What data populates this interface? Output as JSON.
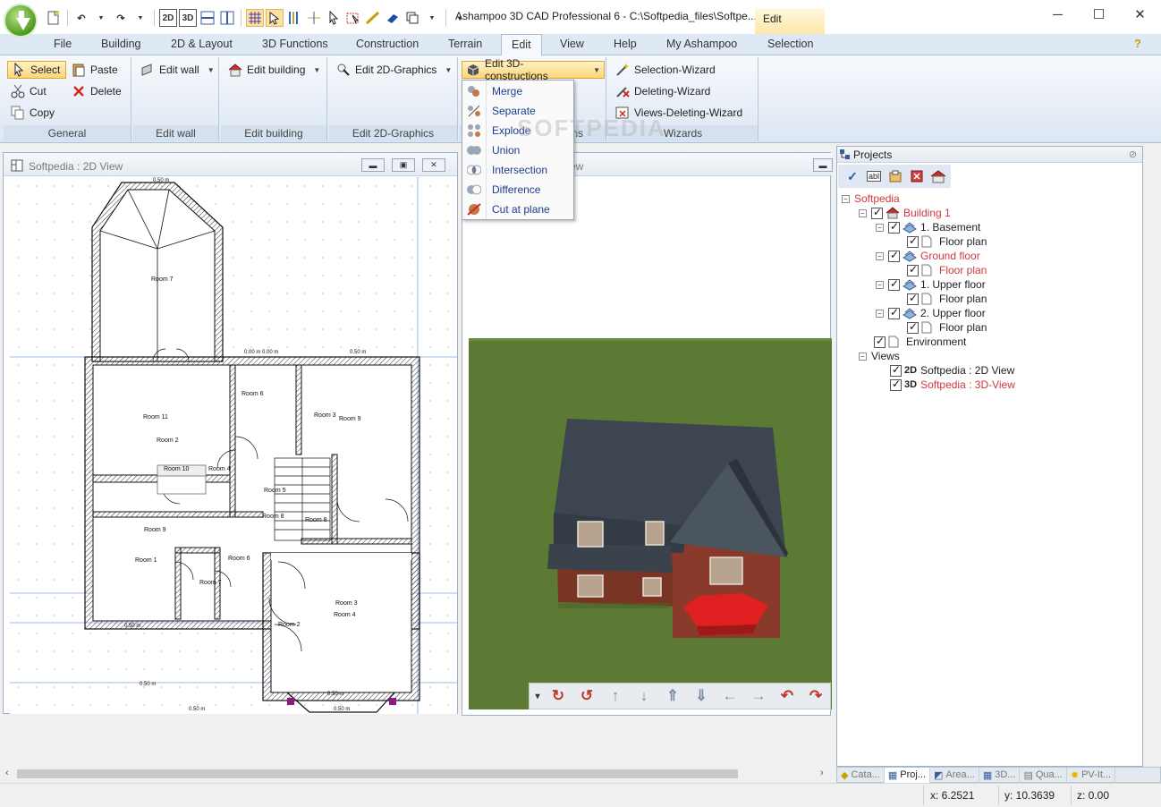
{
  "window": {
    "title": "Ashampoo 3D CAD Professional 6 - C:\\Softpedia_files\\Softpe...",
    "context_tab": "Edit",
    "minimize": "─",
    "maximize": "☐",
    "close": "✕"
  },
  "quick_access": [
    {
      "name": "new-icon",
      "label": ""
    },
    {
      "name": "undo-icon",
      "label": "↶"
    },
    {
      "name": "redo-icon",
      "label": "↷"
    },
    {
      "name": "view-2d-icon",
      "label": "2D"
    },
    {
      "name": "view-3d-icon",
      "label": "3D"
    }
  ],
  "ribbon_tabs": [
    "File",
    "Building",
    "2D & Layout",
    "3D Functions",
    "Construction",
    "Terrain",
    "Edit",
    "View",
    "Help",
    "My Ashampoo",
    "Selection"
  ],
  "active_tab": "Edit",
  "ribbon": {
    "general": {
      "label": "General",
      "select": "Select",
      "cut": "Cut",
      "copy": "Copy",
      "paste": "Paste",
      "delete": "Delete"
    },
    "edit_wall": {
      "label": "Edit wall",
      "button": "Edit wall"
    },
    "edit_building": {
      "label": "Edit building",
      "button": "Edit building"
    },
    "edit_2d": {
      "label": "Edit 2D-Graphics",
      "button": "Edit 2D-Graphics"
    },
    "edit_3d": {
      "button": "Edit 3D-constructions",
      "group_label_partial": "ns"
    },
    "wizards": {
      "label": "Wizards",
      "selection": "Selection-Wizard",
      "deleting": "Deleting-Wizard",
      "views_deleting": "Views-Deleting-Wizard"
    }
  },
  "dropdown_3d": [
    "Merge",
    "Separate",
    "Explode",
    "Union",
    "Intersection",
    "Difference",
    "Cut at plane"
  ],
  "watermark": "SOFTPEDIA",
  "view2d": {
    "title": "Softpedia : 2D View",
    "rooms": [
      {
        "label": "Room 7"
      },
      {
        "label": "Room 11"
      },
      {
        "label": "Room 2"
      },
      {
        "label": "Room 6"
      },
      {
        "label": "Room 3"
      },
      {
        "label": "Room 9"
      },
      {
        "label": "Room 10"
      },
      {
        "label": "Room 4"
      },
      {
        "label": "Room 5"
      },
      {
        "label": "Room 8"
      },
      {
        "label": "Room 1"
      },
      {
        "label": "Room 9"
      },
      {
        "label": "Room 6"
      },
      {
        "label": "Room 3"
      },
      {
        "label": "Room 4"
      },
      {
        "label": "Room 2"
      },
      {
        "label": "Room 8"
      },
      {
        "label": "Room 7"
      }
    ],
    "dims": [
      "0.50 m",
      "0.50 m",
      "0.50 m",
      "0.00 m 0.00 m",
      "0.50 m",
      "0.50 m",
      "0.50 m",
      "0.50 m"
    ]
  },
  "view3d": {
    "title_partial": "ew"
  },
  "nav_toolbar": [
    "▾",
    "↻",
    "↺",
    "↑",
    "↓",
    "⇑",
    "⇓",
    "←",
    "→",
    "↶",
    "↷"
  ],
  "projects": {
    "title": "Projects",
    "toolbar": [
      "check-icon",
      "rename-icon",
      "properties-icon",
      "delete-icon",
      "building-icon"
    ],
    "tree": {
      "root": "Softpedia",
      "building": "Building 1",
      "floors": [
        {
          "name": "1. Basement",
          "plan": "Floor plan",
          "highlight": false
        },
        {
          "name": "Ground floor",
          "plan": "Floor plan",
          "highlight": true
        },
        {
          "name": "1. Upper floor",
          "plan": "Floor plan",
          "highlight": false
        },
        {
          "name": "2. Upper floor",
          "plan": "Floor plan",
          "highlight": false
        }
      ],
      "environment": "Environment",
      "views_label": "Views",
      "views": [
        {
          "badge": "2D",
          "name": "Softpedia : 2D View",
          "highlight": false
        },
        {
          "badge": "3D",
          "name": "Softpedia : 3D-View",
          "highlight": true
        }
      ]
    }
  },
  "panel_tabs": [
    "Cata...",
    "Proj...",
    "Area...",
    "3D...",
    "Qua...",
    "PV-It..."
  ],
  "status": {
    "x": "x: 6.2521",
    "y": "y: 10.3639",
    "z": "z: 0.00"
  },
  "colors": {
    "accent": "#fbd67a",
    "highlight_red": "#d0383e",
    "menu_text": "#1d3c8f",
    "grass": "#5c7a34",
    "roof": "#3d4650",
    "brick": "#8a3a2a"
  }
}
